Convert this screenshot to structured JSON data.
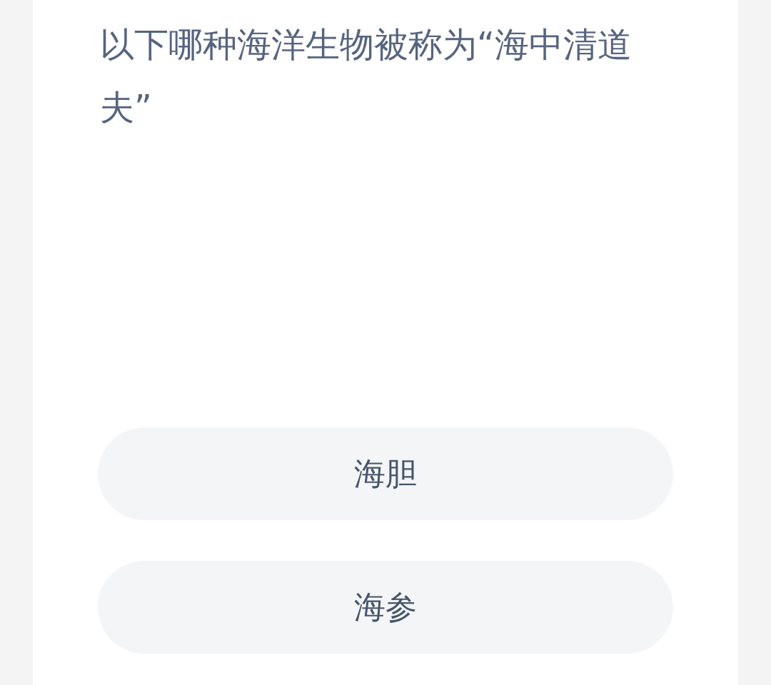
{
  "question": "以下哪种海洋生物被称为“海中清道夫”",
  "options": [
    {
      "label": "海胆"
    },
    {
      "label": "海参"
    }
  ]
}
